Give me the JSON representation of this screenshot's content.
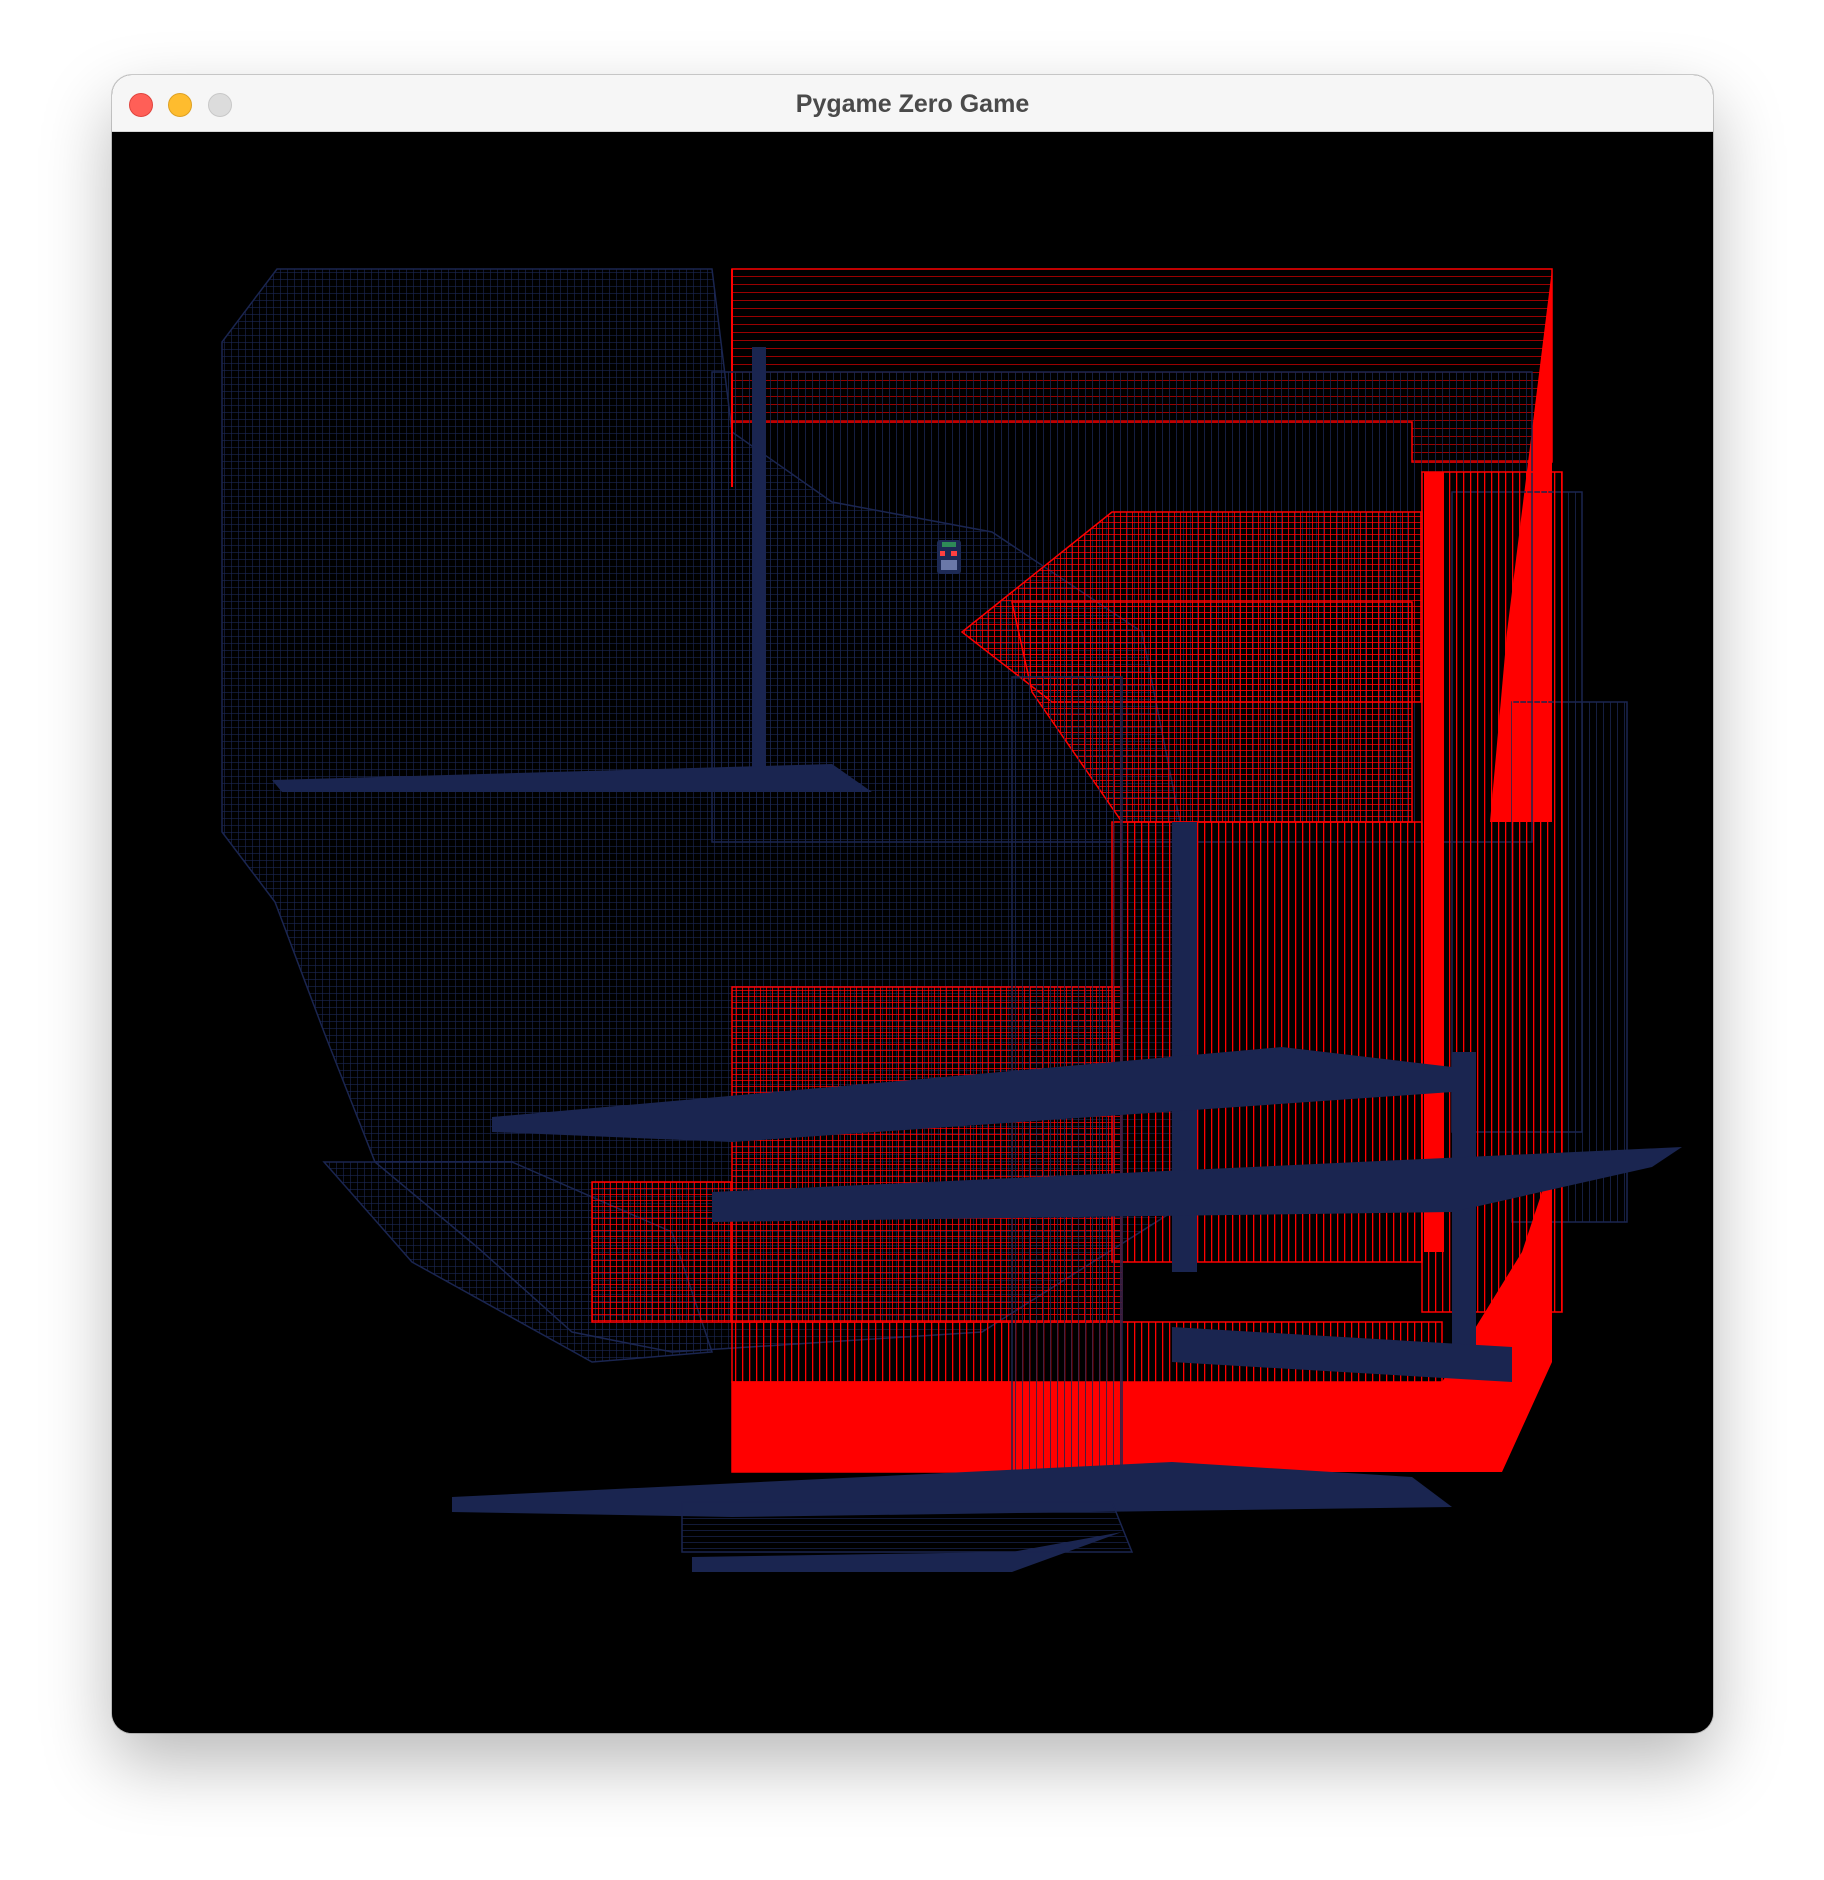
{
  "window": {
    "title": "Pygame Zero Game"
  },
  "titlebar_buttons": {
    "close_color": "#ff5f57",
    "minimize_color": "#febc2e",
    "zoom_color": "#dcdcdc"
  },
  "game": {
    "background_color": "#000000",
    "palette": {
      "navy": "#1a2550",
      "red": "#ff0000"
    },
    "sprite": {
      "icon": "robot-character-icon",
      "colors": [
        "#2e8b57",
        "#ff4040",
        "#6a78a8"
      ]
    }
  }
}
